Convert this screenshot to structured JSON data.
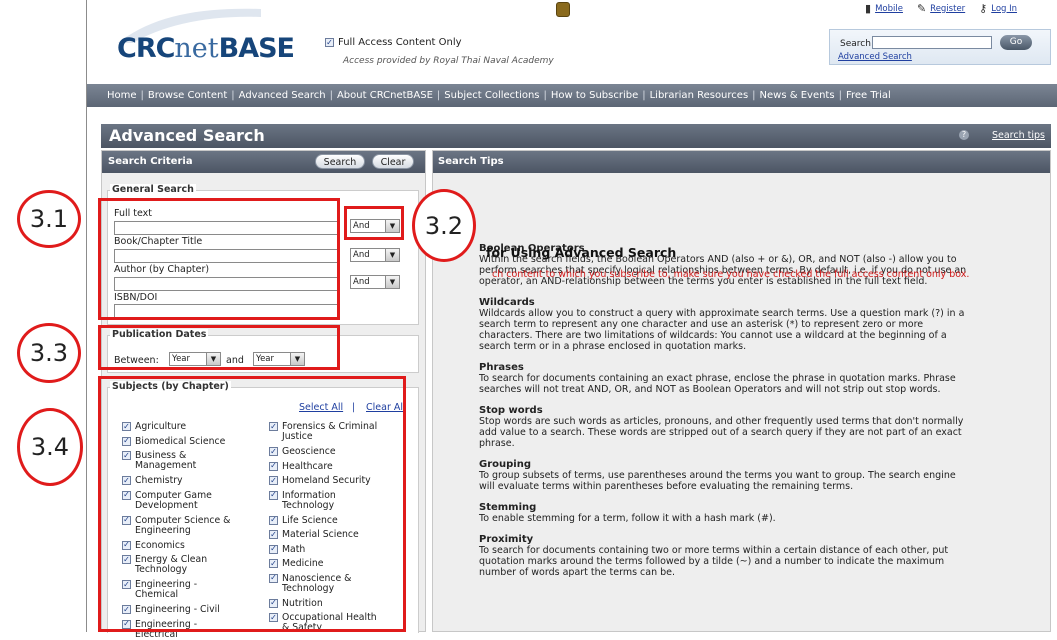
{
  "header": {
    "logo": "CRCnetBASE",
    "logo_a": "CRC",
    "logo_b": "net",
    "logo_c": "BASE",
    "full_access_label": "Full Access Content Only",
    "access_provided": "Access provided by Royal Thai Naval Academy",
    "links": {
      "mobile": "Mobile",
      "register": "Register",
      "login": "Log In"
    },
    "search_label": "Search",
    "go_label": "Go",
    "advanced_search_link": "Advanced Search"
  },
  "nav": {
    "items": [
      "Home",
      "Browse Content",
      "Advanced Search",
      "About CRCnetBASE",
      "Subject Collections",
      "How to Subscribe",
      "Librarian Resources",
      "News & Events",
      "Free Trial"
    ]
  },
  "title": {
    "text": "Advanced Search",
    "search_tips": "Search tips"
  },
  "criteria": {
    "header": "Search Criteria",
    "search_btn": "Search",
    "clear_btn": "Clear",
    "general_legend": "General Search",
    "fields": [
      {
        "label": "Full text",
        "operator": "And"
      },
      {
        "label": "Book/Chapter Title",
        "operator": "And"
      },
      {
        "label": "Author (by Chapter)",
        "operator": "And"
      },
      {
        "label": "ISBN/DOI"
      }
    ],
    "dates_legend": "Publication Dates",
    "between_label": "Between:",
    "from_year": "Year",
    "and_label": "and",
    "to_year": "Year",
    "subjects_legend": "Subjects (by Chapter)",
    "select_all": "Select All",
    "clear_all": "Clear All",
    "subjects_left": [
      [
        "Agriculture"
      ],
      [
        "Biomedical Science"
      ],
      [
        "Business &",
        "Management"
      ],
      [
        "Chemistry"
      ],
      [
        "Computer Game",
        "Development"
      ],
      [
        "Computer Science &",
        "Engineering"
      ],
      [
        "Economics"
      ],
      [
        "Energy & Clean",
        "Technology"
      ],
      [
        "Engineering -",
        "Chemical"
      ],
      [
        "Engineering - Civil"
      ],
      [
        "Engineering -",
        "Electrical"
      ]
    ],
    "subjects_right": [
      [
        "Forensics & Criminal",
        "Justice"
      ],
      [
        "Geoscience"
      ],
      [
        "Healthcare"
      ],
      [
        "Homeland Security"
      ],
      [
        "Information",
        "Technology"
      ],
      [
        "Life Science"
      ],
      [
        "Material Science"
      ],
      [
        "Math"
      ],
      [
        "Medicine"
      ],
      [
        "Nanoscience &",
        "Technology"
      ],
      [
        "Nutrition"
      ],
      [
        "Occupational Health",
        "& Safety"
      ]
    ]
  },
  "tips": {
    "header": "Search Tips",
    "title": "for Using Advanced Search",
    "note": "ch content to which you subscribe to, make sure you have checked the full access content only box.",
    "sections": [
      {
        "heading": "Boolean Operators",
        "lines": [
          "Within the search fields, the Boolean Operators AND (also + or &), OR, and NOT (also -) allow you to",
          "perform searches that specify logical relationships between terms. By default, i.e. if you do not use an",
          "operator, an AND-relationship between the terms you enter is established in the full text field."
        ]
      },
      {
        "heading": "Wildcards",
        "lines": [
          "Wildcards allow you to construct a query with approximate search terms. Use a question mark (?) in a",
          "search term to represent any one character and use an asterisk (*) to represent zero or more",
          "characters. There are two limitations of wildcards: You cannot use a wildcard at the beginning of a",
          "search term or in a phrase enclosed in quotation marks."
        ]
      },
      {
        "heading": "Phrases",
        "lines": [
          "To search for documents containing an exact phrase, enclose the phrase in quotation marks. Phrase",
          "searches will not treat AND, OR, and NOT as Boolean Operators and will not strip out stop words."
        ]
      },
      {
        "heading": "Stop words",
        "lines": [
          "Stop words are such words as articles, pronouns, and other frequently used terms that don't normally",
          "add value to a search. These words are stripped out of a search query if they are not part of an exact",
          "phrase."
        ]
      },
      {
        "heading": "Grouping",
        "lines": [
          "To group subsets of terms, use parentheses around the terms you want to group. The search engine",
          "will evaluate terms within parentheses before evaluating the remaining terms."
        ]
      },
      {
        "heading": "Stemming",
        "lines": [
          "To enable stemming for a term, follow it with a hash mark (#)."
        ]
      },
      {
        "heading": "Proximity",
        "lines": [
          "To search for documents containing two or more terms within a certain distance of each other, put",
          "quotation marks around the terms followed by a tilde (~) and a number to indicate the maximum",
          "number of words apart the terms can be."
        ]
      }
    ]
  },
  "annotations": {
    "a31": "3.1",
    "a32": "3.2",
    "a33": "3.3",
    "a34": "3.4"
  },
  "colors": {
    "annotation": "#e01b1b",
    "header_bar": "#5c6675",
    "link": "#1f3fa0",
    "note": "#d01818"
  }
}
